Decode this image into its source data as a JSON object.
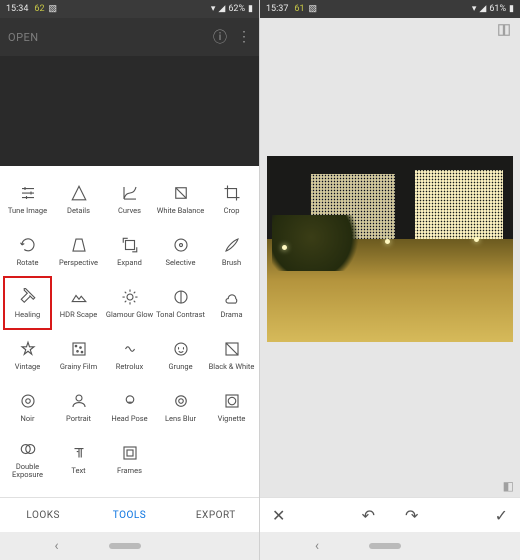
{
  "left": {
    "status": {
      "time": "15:34",
      "level": "62",
      "battery": "62%"
    },
    "header": {
      "open": "OPEN"
    },
    "tools": [
      {
        "key": "tune-image",
        "label": "Tune Image"
      },
      {
        "key": "details",
        "label": "Details"
      },
      {
        "key": "curves",
        "label": "Curves"
      },
      {
        "key": "white-balance",
        "label": "White Balance"
      },
      {
        "key": "crop",
        "label": "Crop"
      },
      {
        "key": "rotate",
        "label": "Rotate"
      },
      {
        "key": "perspective",
        "label": "Perspective"
      },
      {
        "key": "expand",
        "label": "Expand"
      },
      {
        "key": "selective",
        "label": "Selective"
      },
      {
        "key": "brush",
        "label": "Brush"
      },
      {
        "key": "healing",
        "label": "Healing",
        "highlight": true
      },
      {
        "key": "hdr-scape",
        "label": "HDR Scape"
      },
      {
        "key": "glamour-glow",
        "label": "Glamour Glow"
      },
      {
        "key": "tonal-contrast",
        "label": "Tonal Contrast"
      },
      {
        "key": "drama",
        "label": "Drama"
      },
      {
        "key": "vintage",
        "label": "Vintage"
      },
      {
        "key": "grainy-film",
        "label": "Grainy Film"
      },
      {
        "key": "retrolux",
        "label": "Retrolux"
      },
      {
        "key": "grunge",
        "label": "Grunge"
      },
      {
        "key": "black-white",
        "label": "Black & White"
      },
      {
        "key": "noir",
        "label": "Noir"
      },
      {
        "key": "portrait",
        "label": "Portrait"
      },
      {
        "key": "head-pose",
        "label": "Head Pose"
      },
      {
        "key": "lens-blur",
        "label": "Lens Blur"
      },
      {
        "key": "vignette",
        "label": "Vignette"
      },
      {
        "key": "double-exposure",
        "label": "Double Exposure"
      },
      {
        "key": "text",
        "label": "Text"
      },
      {
        "key": "frames",
        "label": "Frames"
      }
    ],
    "tabs": {
      "looks": "LOOKS",
      "tools": "TOOLS",
      "export": "EXPORT",
      "active": "tools"
    }
  },
  "right": {
    "status": {
      "time": "15:37",
      "level": "61",
      "battery": "61%"
    }
  }
}
